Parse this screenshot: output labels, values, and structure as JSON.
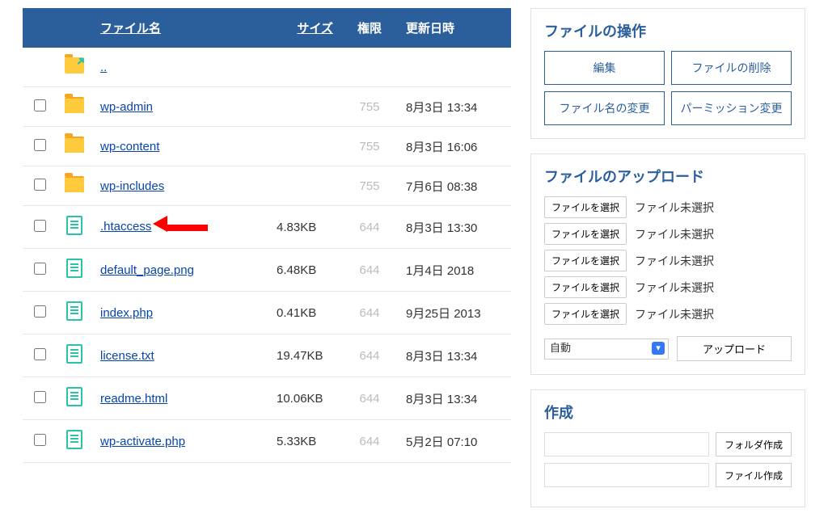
{
  "table": {
    "headers": {
      "name": "ファイル名",
      "size": "サイズ",
      "perm": "権限",
      "date": "更新日時"
    },
    "parent": "..",
    "rows": [
      {
        "type": "folder",
        "name": "wp-admin",
        "size": "",
        "perm": "755",
        "date": "8月3日 13:34",
        "arrow": false
      },
      {
        "type": "folder",
        "name": "wp-content",
        "size": "",
        "perm": "755",
        "date": "8月3日 16:06",
        "arrow": false
      },
      {
        "type": "folder",
        "name": "wp-includes",
        "size": "",
        "perm": "755",
        "date": "7月6日 08:38",
        "arrow": false
      },
      {
        "type": "file",
        "name": ".htaccess",
        "size": "4.83KB",
        "perm": "644",
        "date": "8月3日 13:30",
        "arrow": true
      },
      {
        "type": "file",
        "name": "default_page.png",
        "size": "6.48KB",
        "perm": "644",
        "date": "1月4日 2018",
        "arrow": false
      },
      {
        "type": "file",
        "name": "index.php",
        "size": "0.41KB",
        "perm": "644",
        "date": "9月25日 2013",
        "arrow": false
      },
      {
        "type": "file",
        "name": "license.txt",
        "size": "19.47KB",
        "perm": "644",
        "date": "8月3日 13:34",
        "arrow": false
      },
      {
        "type": "file",
        "name": "readme.html",
        "size": "10.06KB",
        "perm": "644",
        "date": "8月3日 13:34",
        "arrow": false
      },
      {
        "type": "file",
        "name": "wp-activate.php",
        "size": "5.33KB",
        "perm": "644",
        "date": "5月2日 07:10",
        "arrow": false
      }
    ]
  },
  "ops": {
    "title": "ファイルの操作",
    "edit": "編集",
    "delete": "ファイルの削除",
    "rename": "ファイル名の変更",
    "chmod": "パーミッション変更"
  },
  "upload": {
    "title": "ファイルのアップロード",
    "choose": "ファイルを選択",
    "nofile": "ファイル未選択",
    "count": 5,
    "auto": "自動",
    "upload_btn": "アップロード"
  },
  "create": {
    "title": "作成",
    "folder_btn": "フォルダ作成",
    "file_btn": "ファイル作成"
  }
}
